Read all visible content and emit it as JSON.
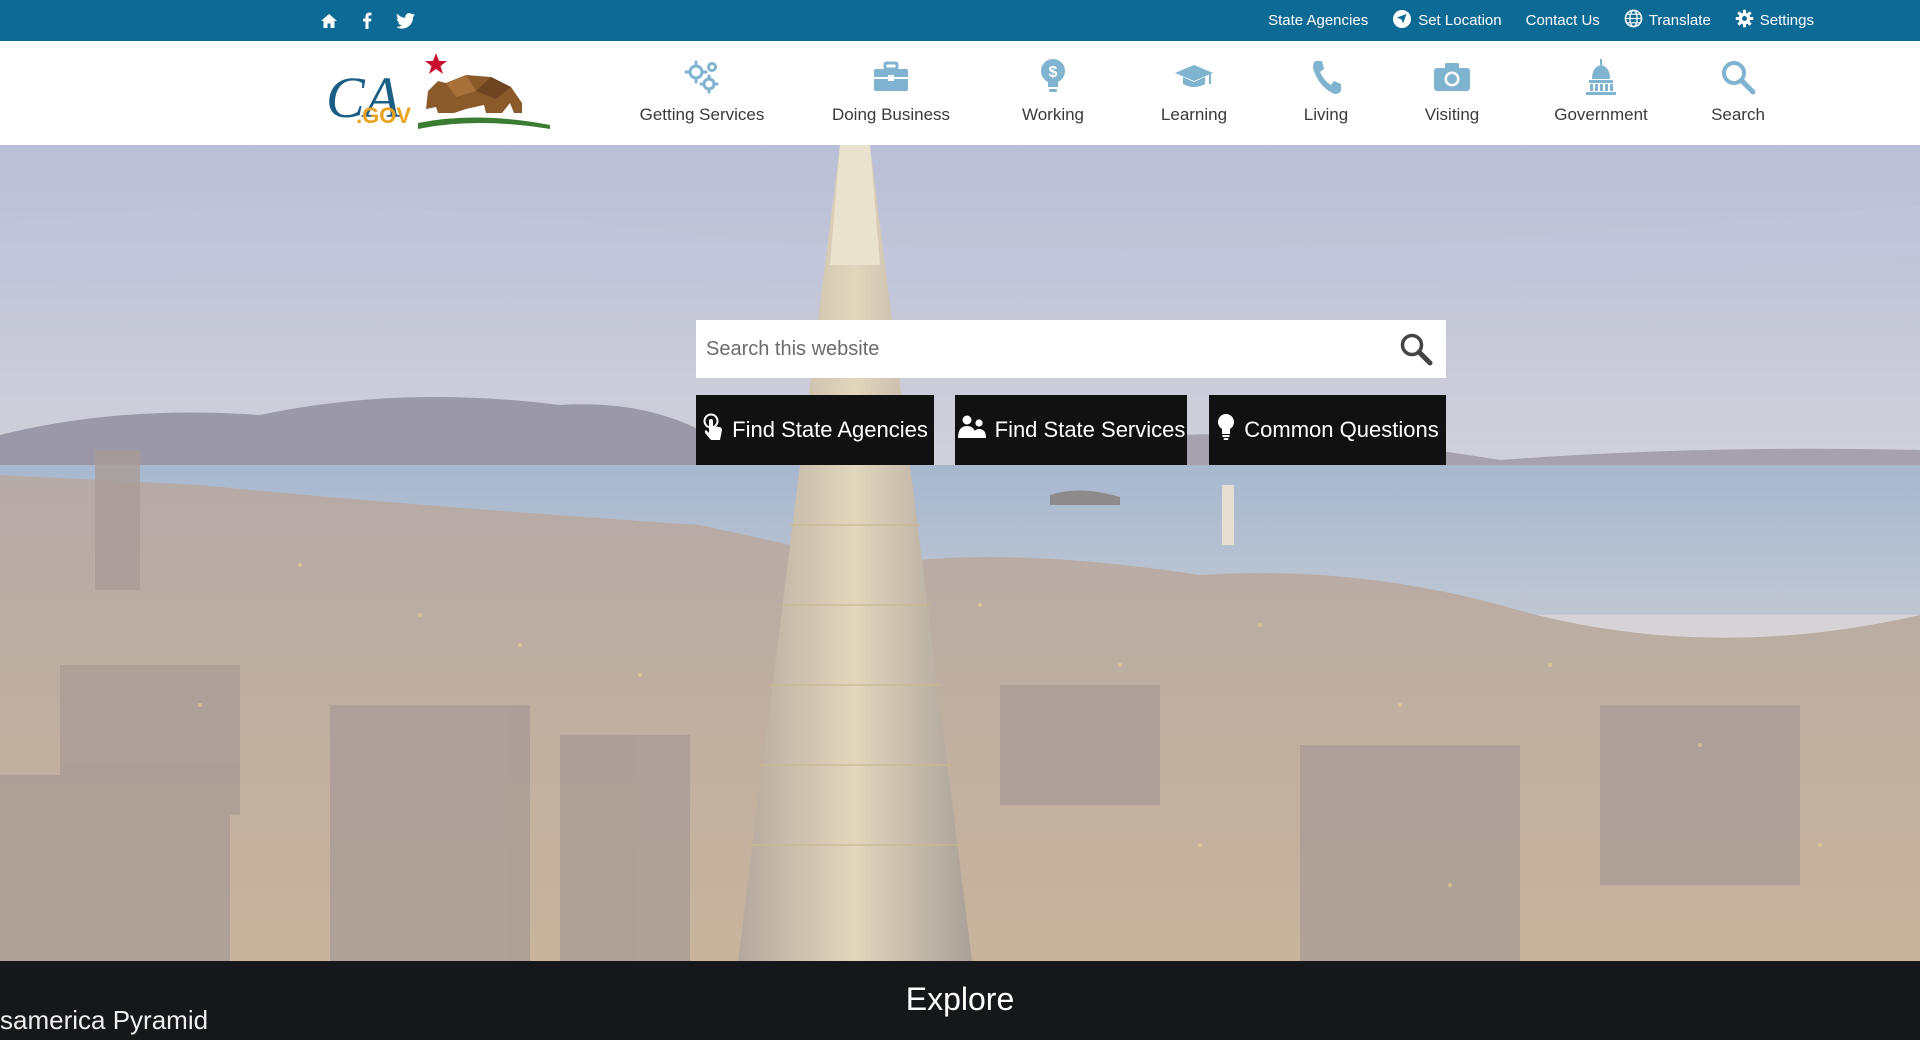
{
  "utility": {
    "links": [
      {
        "label": "State Agencies"
      },
      {
        "label": "Set Location"
      },
      {
        "label": "Contact Us"
      },
      {
        "label": "Translate"
      },
      {
        "label": "Settings"
      }
    ]
  },
  "logo": {
    "text": "CA.GOV"
  },
  "nav": {
    "items": [
      {
        "label": "Getting Services",
        "icon": "gears-icon"
      },
      {
        "label": "Doing Business",
        "icon": "briefcase-icon"
      },
      {
        "label": "Working",
        "icon": "money-bulb-icon"
      },
      {
        "label": "Learning",
        "icon": "graduation-cap-icon"
      },
      {
        "label": "Living",
        "icon": "phone-icon"
      },
      {
        "label": "Visiting",
        "icon": "camera-icon"
      },
      {
        "label": "Government",
        "icon": "capitol-icon"
      },
      {
        "label": "Search",
        "icon": "search-icon"
      }
    ]
  },
  "hero": {
    "search_placeholder": "Search this website",
    "buttons": [
      {
        "label": "Find State Agencies",
        "icon": "hand-pointer-icon"
      },
      {
        "label": "Find State Services",
        "icon": "people-icon"
      },
      {
        "label": "Common Questions",
        "icon": "lightbulb-icon"
      }
    ]
  },
  "strip": {
    "caption": "samerica Pyramid",
    "heading": "Explore"
  },
  "colors": {
    "utility_bar": "#0d6a95",
    "nav_icon": "#7fb3cf",
    "button_bg": "#111111"
  }
}
